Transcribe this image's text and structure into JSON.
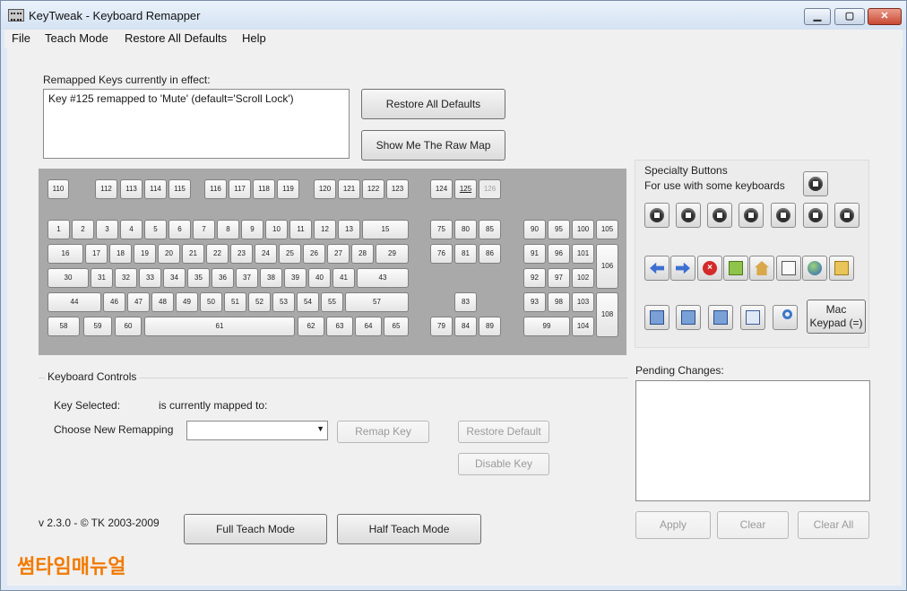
{
  "window": {
    "title": "KeyTweak -  Keyboard Remapper",
    "minimize": "▁",
    "maximize": "▢",
    "close": "✕"
  },
  "menu": {
    "file": "File",
    "teach": "Teach Mode",
    "restore": "Restore All Defaults",
    "help": "Help"
  },
  "remapped": {
    "label": "Remapped Keys currently in effect:",
    "entry": "Key #125 remapped to 'Mute' (default='Scroll Lock')"
  },
  "buttons": {
    "restore_all": "Restore All Defaults",
    "raw_map": "Show Me The Raw Map",
    "remap": "Remap Key",
    "restore_default": "Restore Default",
    "disable": "Disable Key",
    "full_teach": "Full Teach Mode",
    "half_teach": "Half Teach Mode",
    "apply": "Apply",
    "clear": "Clear",
    "clear_all": "Clear All",
    "mac_keypad": "Mac Keypad (=)"
  },
  "controls": {
    "title": "Keyboard Controls",
    "key_selected": "Key Selected:",
    "mapped_to": "is currently mapped to:",
    "choose": "Choose New Remapping",
    "combo_value": ""
  },
  "specialty": {
    "title": "Specialty Buttons",
    "subtitle": "For use with some keyboards"
  },
  "pending": {
    "label": "Pending Changes:"
  },
  "version": "v 2.3.0 - © TK 2003-2009",
  "watermark": "썸타임매뉴얼",
  "keys": {
    "k110": "110",
    "k112": "112",
    "k113": "113",
    "k114": "114",
    "k115": "115",
    "k116": "116",
    "k117": "117",
    "k118": "118",
    "k119": "119",
    "k120": "120",
    "k121": "121",
    "k122": "122",
    "k123": "123",
    "k124": "124",
    "k125": "125",
    "k126": "126",
    "k1": "1",
    "k2": "2",
    "k3": "3",
    "k4": "4",
    "k5": "5",
    "k6": "6",
    "k7": "7",
    "k8": "8",
    "k9": "9",
    "k10": "10",
    "k11": "11",
    "k12": "12",
    "k13": "13",
    "k15": "15",
    "k75": "75",
    "k80": "80",
    "k85": "85",
    "k90": "90",
    "k95": "95",
    "k100": "100",
    "k105": "105",
    "k16": "16",
    "k17": "17",
    "k18": "18",
    "k19": "19",
    "k20": "20",
    "k21": "21",
    "k22": "22",
    "k23": "23",
    "k24": "24",
    "k25": "25",
    "k26": "26",
    "k27": "27",
    "k28": "28",
    "k29": "29",
    "k76": "76",
    "k81": "81",
    "k86": "86",
    "k91": "91",
    "k96": "96",
    "k101": "101",
    "k106": "106",
    "k30": "30",
    "k31": "31",
    "k32": "32",
    "k33": "33",
    "k34": "34",
    "k35": "35",
    "k36": "36",
    "k37": "37",
    "k38": "38",
    "k39": "39",
    "k40": "40",
    "k41": "41",
    "k43": "43",
    "k92": "92",
    "k97": "97",
    "k102": "102",
    "k44": "44",
    "k46": "46",
    "k47": "47",
    "k48": "48",
    "k49": "49",
    "k50": "50",
    "k51": "51",
    "k52": "52",
    "k53": "53",
    "k54": "54",
    "k55": "55",
    "k57": "57",
    "k83": "83",
    "k93": "93",
    "k98": "98",
    "k103": "103",
    "k108": "108",
    "k58": "58",
    "k59": "59",
    "k60": "60",
    "k61": "61",
    "k62": "62",
    "k63": "63",
    "k64": "64",
    "k65": "65",
    "k79": "79",
    "k84": "84",
    "k89": "89",
    "k99": "99",
    "k104": "104"
  }
}
